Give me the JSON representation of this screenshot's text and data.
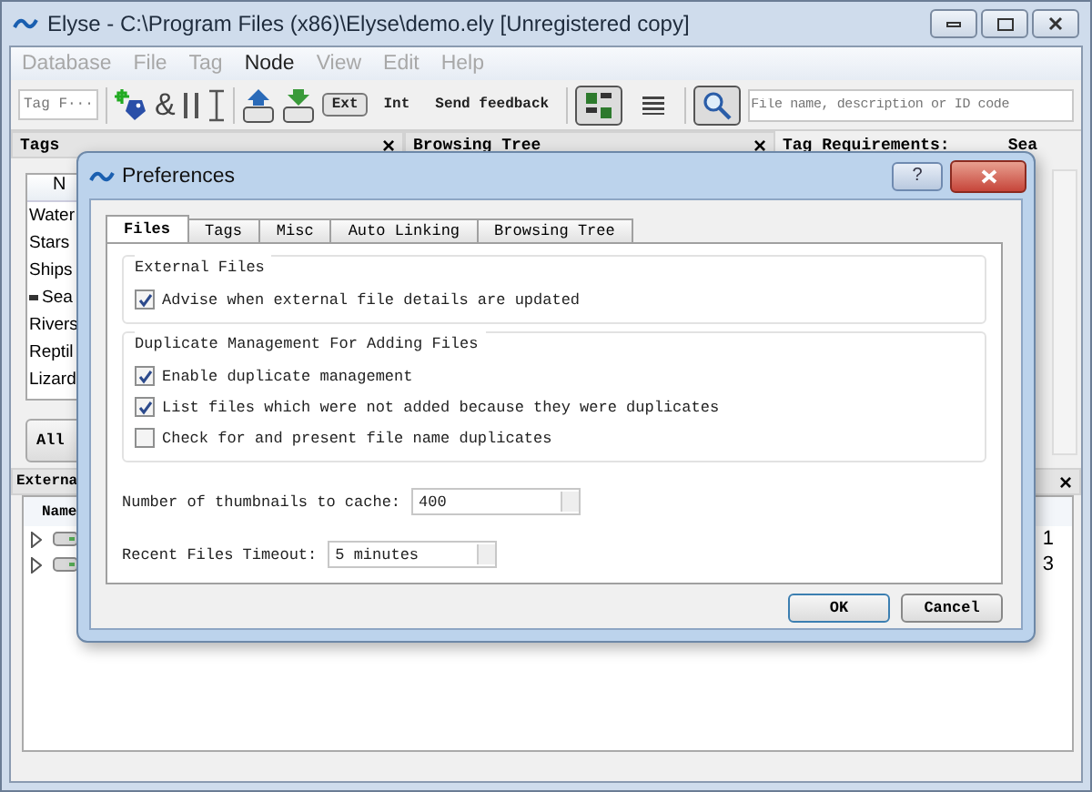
{
  "window": {
    "title": "Elyse - C:\\Program Files (x86)\\Elyse\\demo.ely [Unregistered copy]"
  },
  "menu": [
    {
      "label": "Database",
      "disabled": true
    },
    {
      "label": "File",
      "disabled": true
    },
    {
      "label": "Tag",
      "disabled": true
    },
    {
      "label": "Node",
      "disabled": false
    },
    {
      "label": "View",
      "disabled": true
    },
    {
      "label": "Edit",
      "disabled": true
    },
    {
      "label": "Help",
      "disabled": true
    }
  ],
  "toolbar": {
    "tag_filter": "Tag F···",
    "operator": "&",
    "ext": {
      "label": "Ext",
      "selected": true
    },
    "int": {
      "label": "Int",
      "selected": false
    },
    "feedback": "Send feedback",
    "views": [
      {
        "selected": true
      },
      {
        "selected": false
      }
    ],
    "search": {
      "placeholder": "File name, description or ID code",
      "selected": true
    }
  },
  "tags_panel": {
    "title": "Tags",
    "close": "×",
    "column": "N",
    "items": [
      {
        "label": "Water",
        "marked": false
      },
      {
        "label": "Stars",
        "marked": false
      },
      {
        "label": "Ships",
        "marked": false
      },
      {
        "label": "Sea",
        "marked": true
      },
      {
        "label": "Rivers",
        "marked": false
      },
      {
        "label": "Reptil",
        "marked": false
      },
      {
        "label": "Lizard",
        "marked": false
      }
    ],
    "button": "All"
  },
  "browsing_panel": {
    "title": "Browsing Tree",
    "close": "×"
  },
  "requirements_panel": {
    "label": "Tag Requirements:",
    "value": "Sea"
  },
  "external_panel": {
    "title": "Externa",
    "close": "×",
    "column": "Name",
    "rows": [
      {
        "value": "1"
      },
      {
        "value": "3"
      }
    ]
  },
  "dialog": {
    "title": "Preferences",
    "help": "?",
    "tabs": [
      {
        "label": "Files",
        "selected": true
      },
      {
        "label": "Tags",
        "selected": false
      },
      {
        "label": "Misc",
        "selected": false
      },
      {
        "label": "Auto Linking",
        "selected": false
      },
      {
        "label": "Browsing Tree",
        "selected": false
      }
    ],
    "groups": [
      {
        "title": "External Files",
        "options": [
          {
            "label": "Advise when external file details are updated",
            "checked": true
          }
        ]
      },
      {
        "title": "Duplicate Management For Adding Files",
        "options": [
          {
            "label": "Enable duplicate management",
            "checked": true
          },
          {
            "label": "List files which were not added because they were duplicates",
            "checked": true
          },
          {
            "label": "Check for and present file name duplicates",
            "checked": false
          }
        ]
      }
    ],
    "fields": [
      {
        "label": "Number of thumbnails to cache:",
        "value": "400"
      },
      {
        "label": "Recent Files Timeout:",
        "value": "5 minutes"
      }
    ],
    "buttons": [
      "OK",
      "Cancel"
    ]
  }
}
